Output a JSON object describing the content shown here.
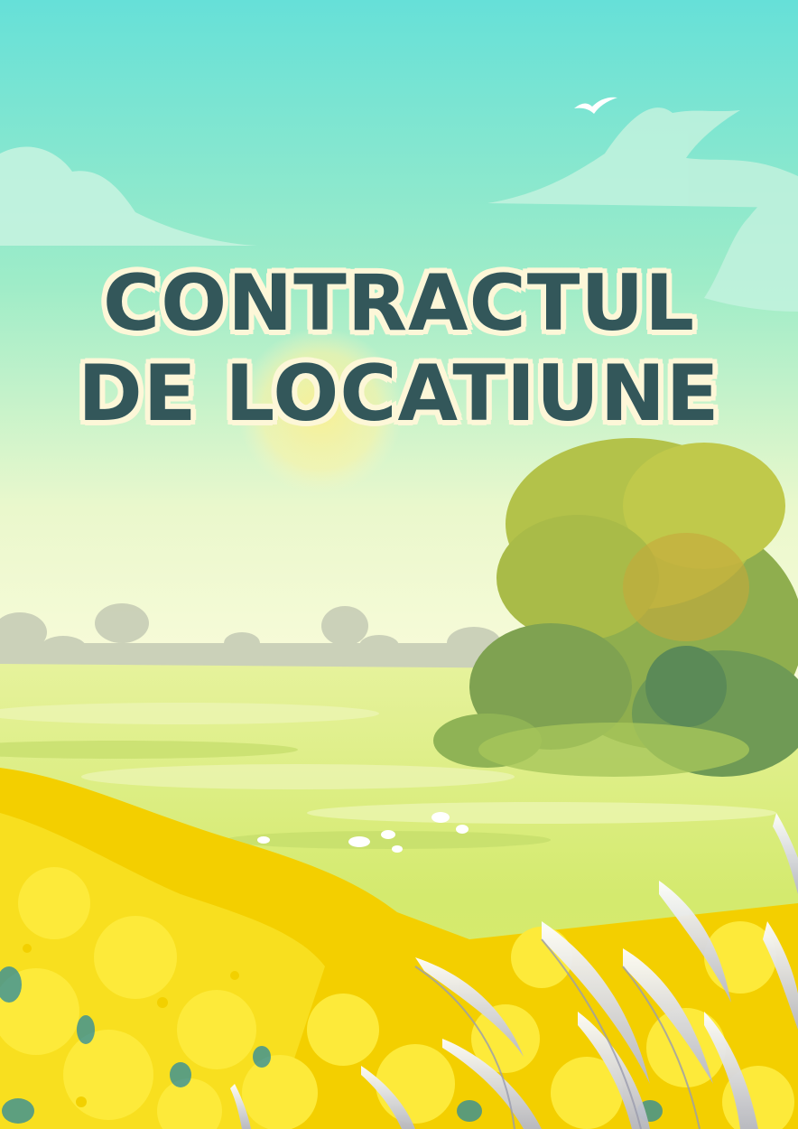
{
  "cover": {
    "title_line_1": "CONTRACTUL",
    "title_line_2": "DE LOCATIUNE"
  },
  "colors": {
    "sky_top": "#66e0d8",
    "sky_bottom": "#f8fbd8",
    "sun": "#fcf3a8",
    "field": "#d9ec70",
    "flowers": "#f4d800",
    "tree": "#9fb34a",
    "title_text": "#33575a",
    "title_outline": "#fdf7d8"
  }
}
